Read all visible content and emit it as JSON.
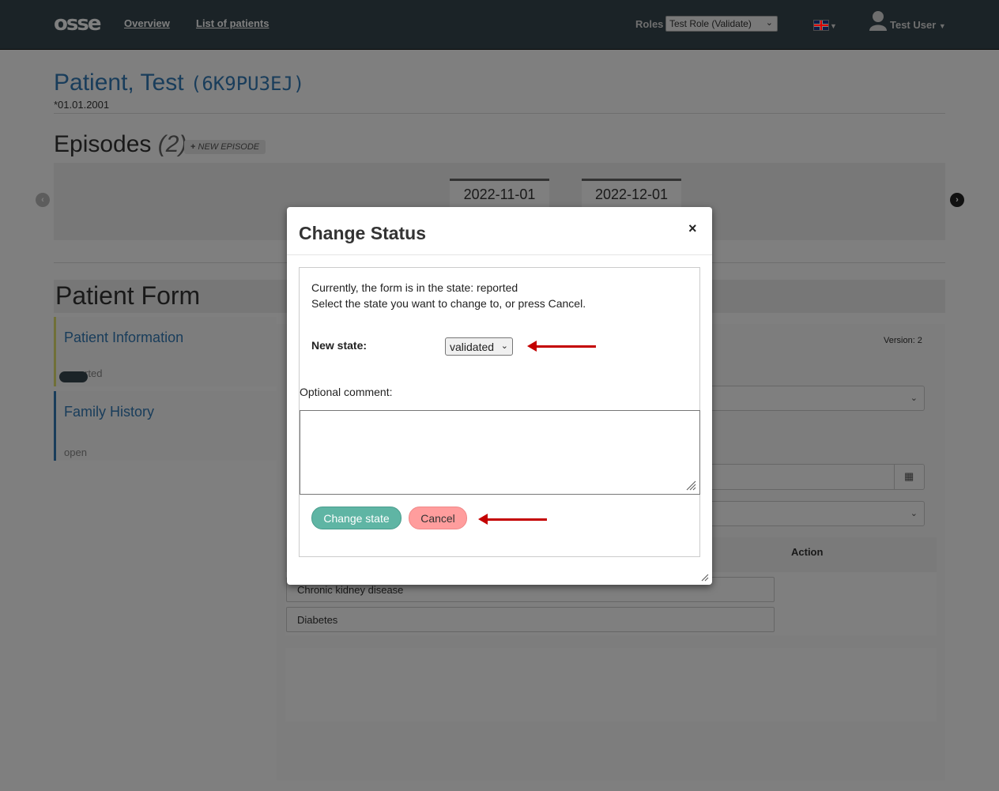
{
  "navbar": {
    "logo": "osse",
    "links": [
      "Overview",
      "List of patients"
    ],
    "roles_label": "Roles",
    "roles_value": "Test Role (Validate)",
    "user_name": "Test User"
  },
  "patient": {
    "name": "Patient, Test",
    "id": "(6K9PU3EJ)",
    "dob": "*01.01.2001"
  },
  "episodes": {
    "title": "Episodes",
    "count": "(2)",
    "new_label": "NEW EPISODE",
    "tabs": [
      "2022-11-01",
      "2022-12-01"
    ]
  },
  "form": {
    "title": "Patient Form",
    "sections": [
      {
        "name": "Patient Information",
        "status": "reported"
      },
      {
        "name": "Family History",
        "status": "open"
      }
    ],
    "version": "Version: 2",
    "action_header": "Action",
    "rows": [
      "Chronic kidney disease",
      "Diabetes"
    ]
  },
  "modal": {
    "title": "Change Status",
    "close": "×",
    "message_line1": "Currently, the form is in the state: reported",
    "message_line2": "Select the state you want to change to, or press Cancel.",
    "new_state_label": "New state:",
    "new_state_value": "validated",
    "comment_label": "Optional comment:",
    "comment_value": "",
    "change_button": "Change state",
    "cancel_button": "Cancel"
  },
  "colors": {
    "navbar": "#37474f",
    "link": "#337ab7",
    "change_button": "#5fb5a4",
    "cancel_button": "#ff9d9d",
    "annotation_arrow": "#c40000"
  }
}
